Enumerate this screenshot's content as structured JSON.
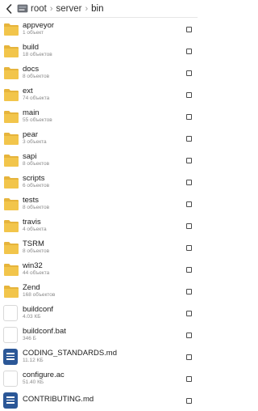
{
  "header": {
    "back_icon": "chevron-left-icon",
    "drive_icon": "storage-drive-icon",
    "breadcrumb": [
      "root",
      "server",
      "bin"
    ],
    "separator": "›"
  },
  "colors": {
    "folder": "#f2c54b",
    "folder_tab": "#e6b43c",
    "doc_icon": "#2b5797"
  },
  "items": [
    {
      "name": "appveyor",
      "meta": "1 объект",
      "type": "folder"
    },
    {
      "name": "build",
      "meta": "18 объектов",
      "type": "folder"
    },
    {
      "name": "docs",
      "meta": "8 объектов",
      "type": "folder"
    },
    {
      "name": "ext",
      "meta": "74 объекта",
      "type": "folder"
    },
    {
      "name": "main",
      "meta": "55 объектов",
      "type": "folder"
    },
    {
      "name": "pear",
      "meta": "3 объекта",
      "type": "folder"
    },
    {
      "name": "sapi",
      "meta": "8 объектов",
      "type": "folder"
    },
    {
      "name": "scripts",
      "meta": "6 объектов",
      "type": "folder"
    },
    {
      "name": "tests",
      "meta": "8 объектов",
      "type": "folder"
    },
    {
      "name": "travis",
      "meta": "4 объекта",
      "type": "folder"
    },
    {
      "name": "TSRM",
      "meta": "8 объектов",
      "type": "folder"
    },
    {
      "name": "win32",
      "meta": "44 объекта",
      "type": "folder"
    },
    {
      "name": "Zend",
      "meta": "168 объектов",
      "type": "folder"
    },
    {
      "name": "buildconf",
      "meta": "4.03 КБ",
      "type": "file"
    },
    {
      "name": "buildconf.bat",
      "meta": "346 Б",
      "type": "file"
    },
    {
      "name": "CODING_STANDARDS.md",
      "meta": "11.12 КБ",
      "type": "doc"
    },
    {
      "name": "configure.ac",
      "meta": "51.40 КБ",
      "type": "file"
    },
    {
      "name": "CONTRIBUTING.md",
      "meta": "",
      "type": "doc"
    }
  ]
}
